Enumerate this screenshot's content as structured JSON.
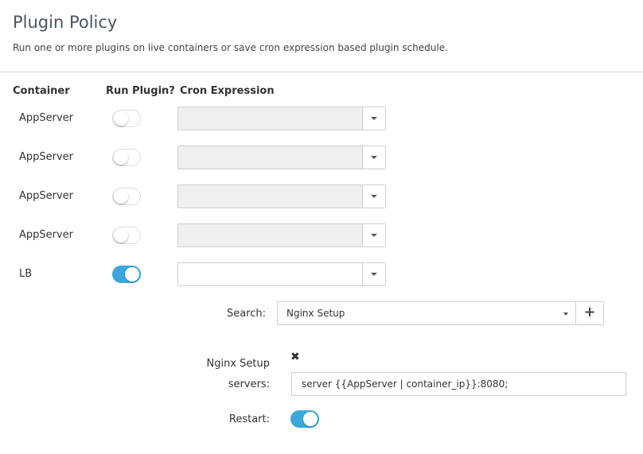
{
  "header": {
    "title": "Plugin Policy",
    "subtitle": "Run one or more plugins on live containers or save cron expression based plugin schedule."
  },
  "columns": {
    "container": "Container",
    "run_plugin": "Run Plugin?",
    "cron_expression": "Cron Expression"
  },
  "rows": [
    {
      "container": "AppServer",
      "run_plugin": false,
      "cron_expression": ""
    },
    {
      "container": "AppServer",
      "run_plugin": false,
      "cron_expression": ""
    },
    {
      "container": "AppServer",
      "run_plugin": false,
      "cron_expression": ""
    },
    {
      "container": "AppServer",
      "run_plugin": false,
      "cron_expression": ""
    },
    {
      "container": "LB",
      "run_plugin": true,
      "cron_expression": ""
    }
  ],
  "plugin_form": {
    "search_label": "Search:",
    "search_value": "Nginx Setup",
    "add_icon": "plus-icon",
    "plugin_name": "Nginx Setup",
    "remove_icon": "close-icon",
    "servers_label": "servers:",
    "servers_value": "server {{AppServer | container_ip}}:8080;",
    "restart_label": "Restart:",
    "restart_on": true
  },
  "colors": {
    "accent": "#3aa8da",
    "title": "#4a5561",
    "disabled_select": "#efefef"
  }
}
